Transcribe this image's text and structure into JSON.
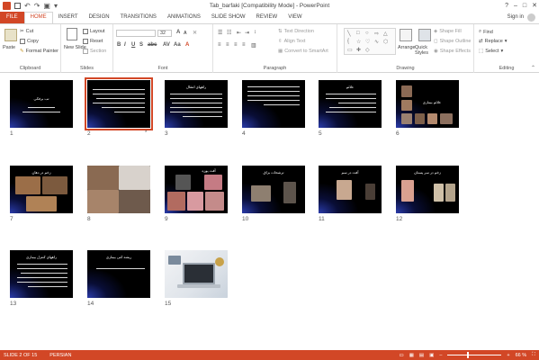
{
  "window": {
    "title": "Tab_barfaki [Compatibility Mode] - PowerPoint",
    "controls": [
      "?",
      "–",
      "□",
      "✕"
    ]
  },
  "tabs": [
    "FILE",
    "HOME",
    "INSERT",
    "DESIGN",
    "TRANSITIONS",
    "ANIMATIONS",
    "SLIDE SHOW",
    "REVIEW",
    "VIEW"
  ],
  "active_tab": "HOME",
  "signin": "Sign in",
  "ribbon": {
    "clipboard": {
      "paste": "Paste",
      "cut": "Cut",
      "copy": "Copy",
      "format_painter": "Format Painter",
      "label": "Clipboard"
    },
    "slides": {
      "new_slide": "New Slide",
      "layout": "Layout",
      "reset": "Reset",
      "section": "Section",
      "label": "Slides"
    },
    "font": {
      "size": "32",
      "label": "Font"
    },
    "paragraph": {
      "text_direction": "Text Direction",
      "align_text": "Align Text",
      "smartart": "Convert to SmartArt",
      "label": "Paragraph"
    },
    "drawing": {
      "arrange": "Arrange",
      "quick_styles": "Quick Styles",
      "shape_fill": "Shape Fill",
      "shape_outline": "Shape Outline",
      "shape_effects": "Shape Effects",
      "label": "Drawing"
    },
    "editing": {
      "find": "Find",
      "replace": "Replace",
      "select": "Select",
      "label": "Editing"
    }
  },
  "slides": [
    {
      "num": "1",
      "title": "تب برفکی"
    },
    {
      "num": "2",
      "title": "",
      "selected": true,
      "marker": "*"
    },
    {
      "num": "3",
      "title": "راههای انتقال"
    },
    {
      "num": "4",
      "title": ""
    },
    {
      "num": "5",
      "title": "علائم"
    },
    {
      "num": "6",
      "title": "علائم بیماری"
    },
    {
      "num": "7",
      "title": "زخم در دهان"
    },
    {
      "num": "8",
      "title": ""
    },
    {
      "num": "9",
      "title": "آفت پوزه"
    },
    {
      "num": "10",
      "title": "ترشحات بزاق"
    },
    {
      "num": "11",
      "title": "آفت در سم"
    },
    {
      "num": "12",
      "title": "زخم در سر پستان"
    },
    {
      "num": "13",
      "title": "راههای کنترل بیماری"
    },
    {
      "num": "14",
      "title": "ریشه کنی بیماری"
    },
    {
      "num": "15",
      "title": ""
    }
  ],
  "status": {
    "slide": "SLIDE 2 OF 15",
    "language": "PERSIAN",
    "zoom": "66 %"
  },
  "colors": {
    "accent": "#d24726",
    "slide_bg": "#000000",
    "slide_glow": "#3246c8"
  }
}
